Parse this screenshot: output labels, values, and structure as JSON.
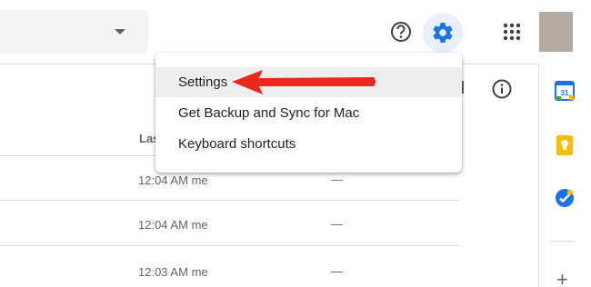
{
  "header": {
    "search": {
      "dropdown_icon": "caret-down-icon"
    },
    "help_icon": "help-circle-icon",
    "settings_icon": "gear-icon",
    "apps_icon": "apps-grid-icon",
    "accent_color": "#1a73e8",
    "settings_highlight": "#e8f0fe"
  },
  "toolbar": {
    "info_icon": "info-icon"
  },
  "file_list": {
    "column_header": "Las",
    "rows": [
      {
        "time": "12:04 AM",
        "owner": "me",
        "size": "—"
      },
      {
        "time": "12:04 AM",
        "owner": "me",
        "size": "—"
      },
      {
        "time": "12:03 AM",
        "owner": "me",
        "size": "—"
      }
    ]
  },
  "settings_menu": {
    "items": [
      {
        "label": "Settings",
        "highlighted": true
      },
      {
        "label": "Get Backup and Sync for Mac"
      },
      {
        "label": "Keyboard shortcuts"
      }
    ],
    "annotation_color": "#e8291c"
  },
  "side_panel": {
    "apps": [
      {
        "name": "calendar-icon",
        "text": "31",
        "color": "#1a73e8"
      },
      {
        "name": "keep-icon",
        "color": "#fbbc04"
      },
      {
        "name": "tasks-icon",
        "color": "#1a73e8"
      }
    ],
    "add_label": "+"
  }
}
